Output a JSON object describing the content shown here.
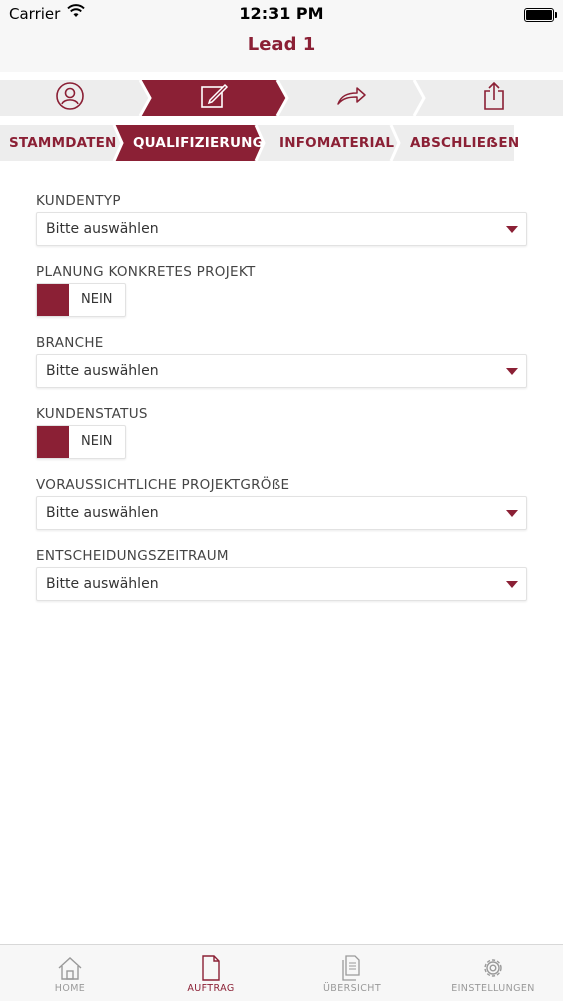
{
  "status_bar": {
    "carrier": "Carrier",
    "time": "12:31 PM"
  },
  "nav": {
    "title": "Lead 1"
  },
  "steps": [
    {
      "icon": "person-circle-icon",
      "active": false
    },
    {
      "icon": "edit-icon",
      "active": true
    },
    {
      "icon": "forward-arrow-icon",
      "active": false
    },
    {
      "icon": "share-icon",
      "active": false
    }
  ],
  "subtabs": {
    "stammdaten": "STAMMDATEN",
    "qualifizierung": "QUALIFIZIERUNG",
    "infomaterial": "INFOMATERIAL",
    "abschliessen": "ABSCHLIEẞEN"
  },
  "form": {
    "kundentyp": {
      "label": "KUNDENTYP",
      "value": "Bitte auswählen"
    },
    "planung": {
      "label": "PLANUNG KONKRETES PROJEKT",
      "value": "NEIN"
    },
    "branche": {
      "label": "BRANCHE",
      "value": "Bitte auswählen"
    },
    "kundenstatus": {
      "label": "KUNDENSTATUS",
      "value": "NEIN"
    },
    "projektgroesse": {
      "label": "VORAUSSICHTLICHE PROJEKTGRÖßE",
      "value": "Bitte auswählen"
    },
    "entscheidung": {
      "label": "ENTSCHEIDUNGSZEITRAUM",
      "value": "Bitte auswählen"
    }
  },
  "tabbar": {
    "home": "HOME",
    "auftrag": "AUFTRAG",
    "uebersicht": "ÜBERSICHT",
    "einstellungen": "EINSTELLUNGEN"
  },
  "colors": {
    "accent": "#8b2035",
    "chevron_bg": "#ededed",
    "bar_bg": "#f7f7f7"
  }
}
